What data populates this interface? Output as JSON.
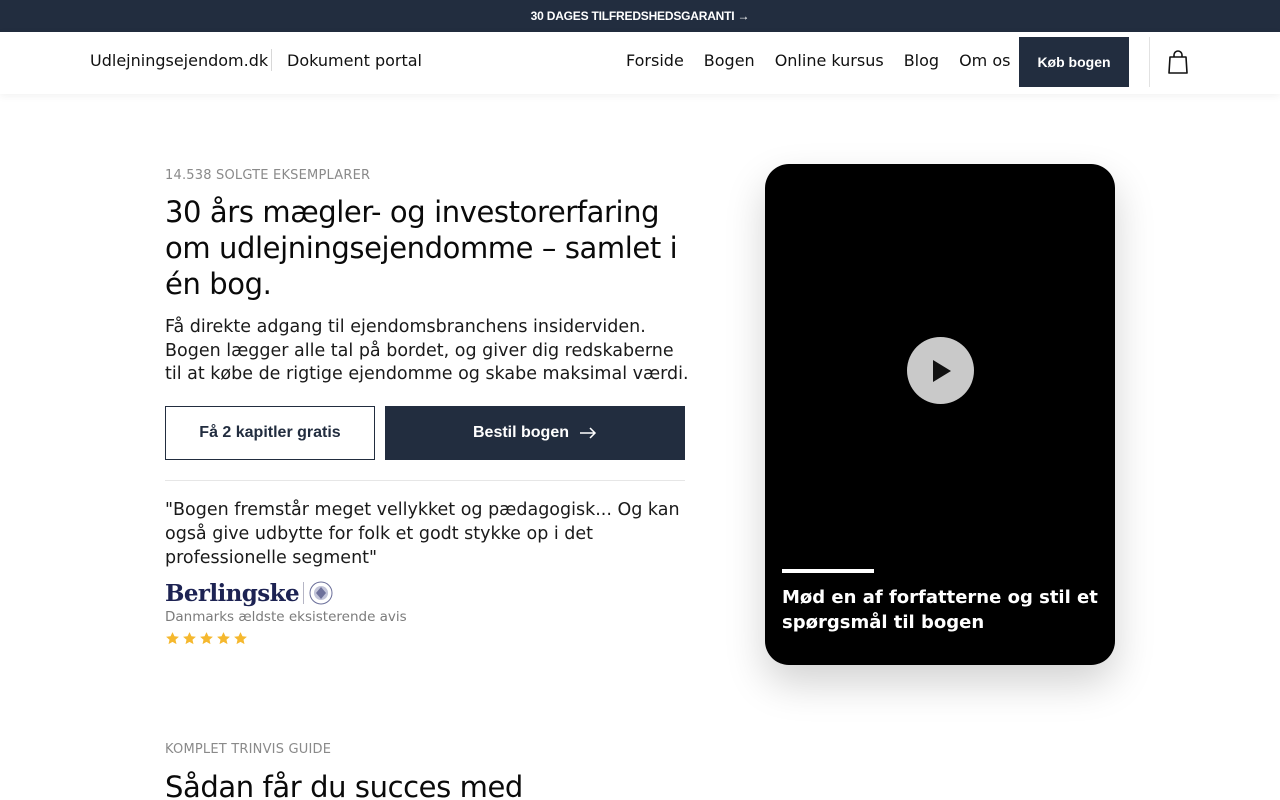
{
  "announcement": {
    "text": "30 DAGES TILFREDSHEDSGARANTI →"
  },
  "nav": {
    "brand": "Udlejningsejendom.dk",
    "portal": "Dokument portal",
    "items": [
      {
        "label": "Forside"
      },
      {
        "label": "Bogen"
      },
      {
        "label": "Online kursus"
      },
      {
        "label": "Blog"
      },
      {
        "label": "Om os"
      }
    ],
    "buy_label": "Køb bogen",
    "cart_icon": "shopping-bag-icon"
  },
  "hero": {
    "eyebrow": "14.538 SOLGTE EKSEMPLARER",
    "title": "30 års mægler- og investorerfaring om udlejningsejendomme – samlet i én bog.",
    "text": "Få direkte adgang til ejendomsbranchens insiderviden. Bogen lægger alle tal på bordet, og giver dig redskaberne til at købe de rigtige ejendomme og skabe maksimal værdi.",
    "btn_free": "Få 2 kapitler gratis",
    "btn_order": "Bestil bogen",
    "btn_order_icon": "arrow-right-icon",
    "quote": "\"Bogen fremstår meget vellykket og pædagogisk... Og kan også give udbytte for folk et godt stykke op i det professionelle segment\"",
    "quote_logo": "Berlingske",
    "quote_source": "Danmarks ældste eksisterende avis",
    "rating": 5,
    "star_color": "#f5b82e"
  },
  "video": {
    "caption": "Mød en af forfatterne og stil et spørgsmål til bogen",
    "play_icon": "play-icon"
  },
  "section2": {
    "eyebrow": "KOMPLET TRINVIS GUIDE",
    "title": "Sådan får du succes med"
  },
  "colors": {
    "dark": "#222d3f",
    "brand_blue": "#1d2353"
  }
}
